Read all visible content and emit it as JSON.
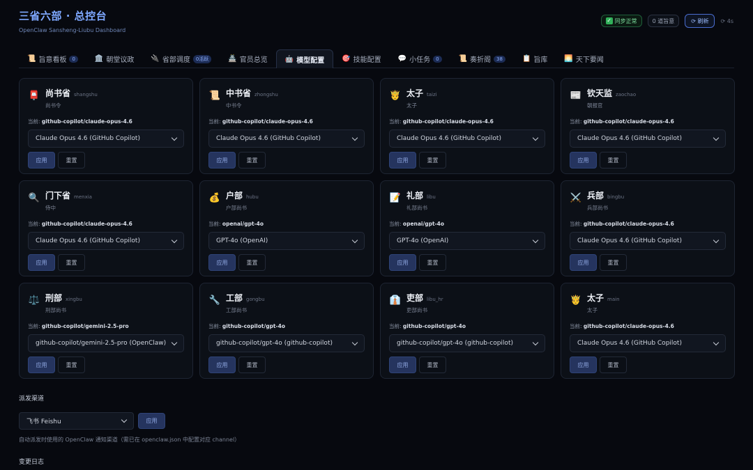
{
  "header": {
    "title": "三省六部 · 总控台",
    "subtitle": "OpenClaw Sansheng-Liubu Dashboard",
    "sync_status": "同步正常",
    "pending": "0 道旨意",
    "refresh": "⟳ 刷新",
    "age": "⟳ 4s"
  },
  "tabs": [
    {
      "icon": "📜",
      "label": "旨意看板",
      "badge": "0"
    },
    {
      "icon": "🏛️",
      "label": "朝堂议政",
      "badge": ""
    },
    {
      "icon": "🔌",
      "label": "省部调度",
      "badge": "0活跃"
    },
    {
      "icon": "🏯",
      "label": "官员总览",
      "badge": ""
    },
    {
      "icon": "🤖",
      "label": "模型配置",
      "badge": "",
      "active": true
    },
    {
      "icon": "🎯",
      "label": "技能配置",
      "badge": ""
    },
    {
      "icon": "💬",
      "label": "小任务",
      "badge": "0"
    },
    {
      "icon": "📜",
      "label": "奏折阁",
      "badge": "38"
    },
    {
      "icon": "📋",
      "label": "旨库",
      "badge": ""
    },
    {
      "icon": "🌅",
      "label": "天下要闻",
      "badge": ""
    }
  ],
  "current_prefix": "当前: ",
  "apply_label": "应用",
  "reset_label": "重置",
  "agents": [
    {
      "icon": "📮",
      "name": "尚书省",
      "id": "shangshu",
      "role": "尚书令",
      "current": "github-copilot/claude-opus-4.6",
      "selected": "Claude Opus 4.6 (GitHub Copilot)"
    },
    {
      "icon": "📜",
      "name": "中书省",
      "id": "zhongshu",
      "role": "中书令",
      "current": "github-copilot/claude-opus-4.6",
      "selected": "Claude Opus 4.6 (GitHub Copilot)"
    },
    {
      "icon": "🤴",
      "name": "太子",
      "id": "taizi",
      "role": "太子",
      "current": "github-copilot/claude-opus-4.6",
      "selected": "Claude Opus 4.6 (GitHub Copilot)"
    },
    {
      "icon": "📰",
      "name": "钦天监",
      "id": "zaochao",
      "role": "朝报官",
      "current": "github-copilot/claude-opus-4.6",
      "selected": "Claude Opus 4.6 (GitHub Copilot)"
    },
    {
      "icon": "🔍",
      "name": "门下省",
      "id": "menxia",
      "role": "侍中",
      "current": "github-copilot/claude-opus-4.6",
      "selected": "Claude Opus 4.6 (GitHub Copilot)"
    },
    {
      "icon": "💰",
      "name": "户部",
      "id": "hubu",
      "role": "户部尚书",
      "current": "openai/gpt-4o",
      "selected": "GPT-4o (OpenAI)"
    },
    {
      "icon": "📝",
      "name": "礼部",
      "id": "libu",
      "role": "礼部尚书",
      "current": "openai/gpt-4o",
      "selected": "GPT-4o (OpenAI)"
    },
    {
      "icon": "⚔️",
      "name": "兵部",
      "id": "bingbu",
      "role": "兵部尚书",
      "current": "github-copilot/claude-opus-4.6",
      "selected": "Claude Opus 4.6 (GitHub Copilot)"
    },
    {
      "icon": "⚖️",
      "name": "刑部",
      "id": "xingbu",
      "role": "刑部尚书",
      "current": "github-copilot/gemini-2.5-pro",
      "selected": "github-copilot/gemini-2.5-pro (OpenClaw)"
    },
    {
      "icon": "🔧",
      "name": "工部",
      "id": "gongbu",
      "role": "工部尚书",
      "current": "github-copilot/gpt-4o",
      "selected": "github-copilot/gpt-4o (github-copilot)"
    },
    {
      "icon": "👔",
      "name": "吏部",
      "id": "libu_hr",
      "role": "吏部尚书",
      "current": "github-copilot/gpt-4o",
      "selected": "github-copilot/gpt-4o (github-copilot)"
    },
    {
      "icon": "🤴",
      "name": "太子",
      "id": "main",
      "role": "太子",
      "current": "github-copilot/claude-opus-4.6",
      "selected": "Claude Opus 4.6 (GitHub Copilot)"
    }
  ],
  "dispatch": {
    "title": "派发渠道",
    "selected": "飞书 Feishu",
    "apply": "应用",
    "hint": "自动派发时使用的 OpenClaw 通知渠道（需已在 openclaw.json 中配置对应 channel）"
  },
  "changelog_title": "变更日志"
}
